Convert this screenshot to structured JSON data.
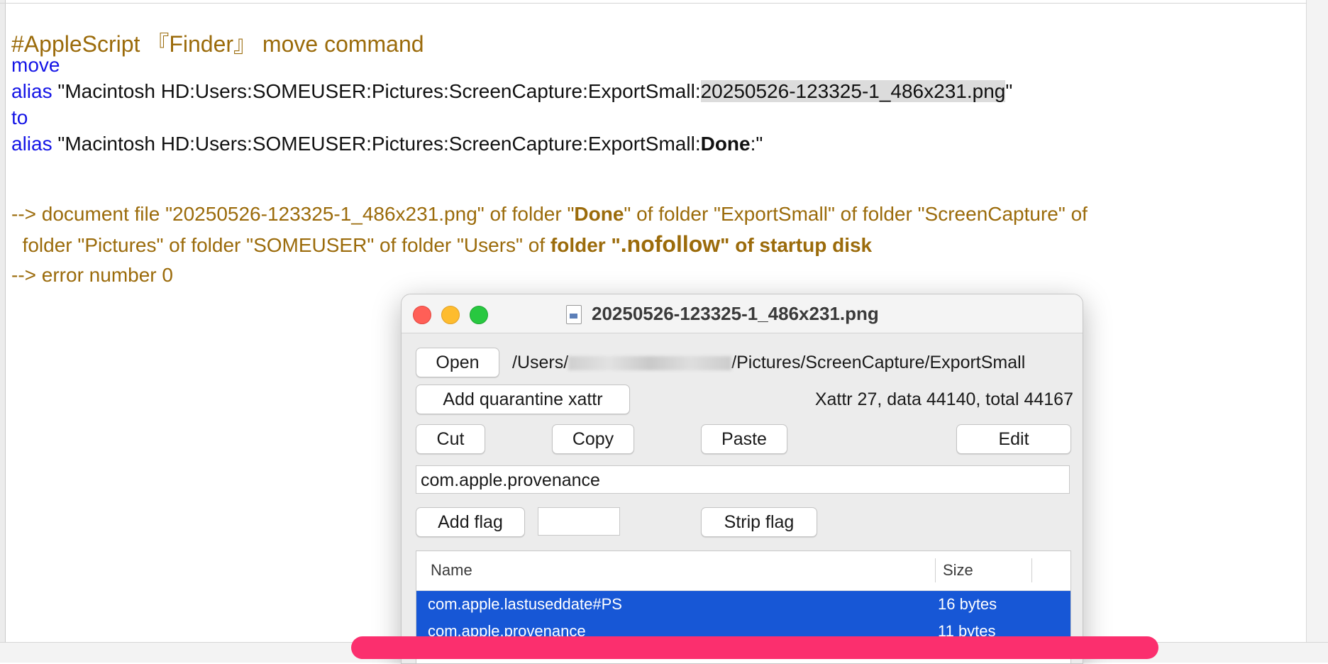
{
  "editor": {
    "title": "#AppleScript 『Finder』 move command",
    "line_move": "move",
    "kw_alias": "alias",
    "path1_prefix": " \"Macintosh HD:Users:SOMEUSER:Pictures:ScreenCapture:ExportSmall:",
    "path1_selected": "20250526-123325-1_486x231.png",
    "path1_suffix": "\"",
    "line_to": "to",
    "path2_prefix": " \"Macintosh HD:Users:SOMEUSER:Pictures:ScreenCapture:ExportSmall:",
    "path2_bold": "Done",
    "path2_suffix": ":\"",
    "result1_a": "--> document file \"20250526-123325-1_486x231.png\" of folder \"",
    "result1_bold": "Done",
    "result1_b": "\" of folder \"ExportSmall\" of folder \"ScreenCapture\" of",
    "result2_a": "  folder \"Pictures\" of folder \"SOMEUSER\" of folder \"Users\" of ",
    "result2_bold_a": "folder \"",
    "result2_bold_big": ".nofollow",
    "result2_bold_b": "\" of startup disk",
    "result3": "--> error number 0"
  },
  "window": {
    "title": "20250526-123325-1_486x231.png",
    "open_button": "Open",
    "path_prefix": "/Users/",
    "path_suffix": "/Pictures/ScreenCapture/ExportSmall",
    "quarantine_button": "Add quarantine xattr",
    "xattr_summary": "Xattr 27, data 44140, total 44167",
    "cut_button": "Cut",
    "copy_button": "Copy",
    "paste_button": "Paste",
    "edit_button": "Edit",
    "attr_name_value": "com.apple.provenance",
    "add_flag_button": "Add flag",
    "flag_value": "",
    "strip_flag_button": "Strip flag",
    "table": {
      "columns": [
        "Name",
        "Size"
      ],
      "rows": [
        {
          "name": "com.apple.lastuseddate#PS",
          "size": "16 bytes"
        },
        {
          "name": "com.apple.provenance",
          "size": "11 bytes"
        }
      ]
    }
  },
  "colors": {
    "keyword": "#1414e6",
    "comment": "#9b6b0b",
    "selection_row": "#1757d6",
    "overlay_bar": "#fb2f6e"
  }
}
